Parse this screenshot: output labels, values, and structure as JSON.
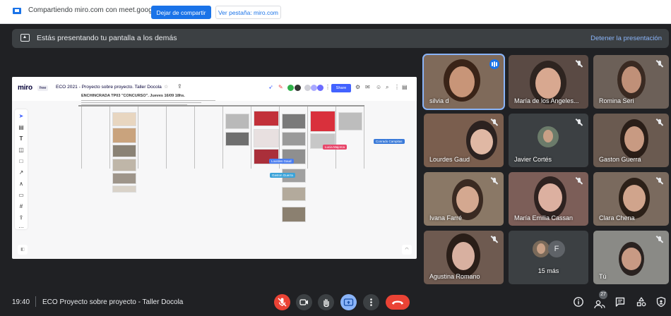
{
  "sharebar": {
    "text": "Compartiendo miro.com con meet.google.com",
    "stop_label": "Dejar de compartir",
    "view_label": "Ver pestaña: miro.com"
  },
  "banner": {
    "text": "Estás presentando tu pantalla a los demás",
    "stop_label": "Detener la presentación"
  },
  "miro": {
    "logo": "miro",
    "plan": "free",
    "board_title": "ECO 2021 - Proyecto sobre proyecto. Taller Docola",
    "share_label": "Share",
    "frame_title": "ENCHINCRADA TP03 \"CONCURSO\". Jueves 16/09 18hs.",
    "cursors": [
      "Lourdes Gaud",
      "Lucia Majorca",
      "Gaston Guerra",
      "Conrado Campitas"
    ]
  },
  "participants": [
    {
      "name": "silvia d",
      "speaking": true
    },
    {
      "name": "María de los Angeles...",
      "muted": true
    },
    {
      "name": "Romina Seri",
      "muted": true
    },
    {
      "name": "Lourdes Gaud",
      "muted": true
    },
    {
      "name": "Javier Cortés",
      "muted": true
    },
    {
      "name": "Gaston Guerra",
      "muted": true
    },
    {
      "name": "Ivana Farré",
      "muted": true
    },
    {
      "name": "María Emilia Cassan",
      "muted": true
    },
    {
      "name": "Clara Chena",
      "muted": true
    },
    {
      "name": "Agustina Romano",
      "muted": true
    },
    {
      "name": "15 más",
      "initial": "F"
    },
    {
      "name": "Tú",
      "muted": true
    }
  ],
  "bottom": {
    "time": "19:40",
    "meeting": "ECO Proyecto sobre proyecto - Taller Docola",
    "people_count": "27"
  },
  "colors": {
    "accent": "#1a73e8",
    "danger": "#ea4335",
    "present_active": "#8ab4f8",
    "miro_blue": "#4262ff"
  }
}
